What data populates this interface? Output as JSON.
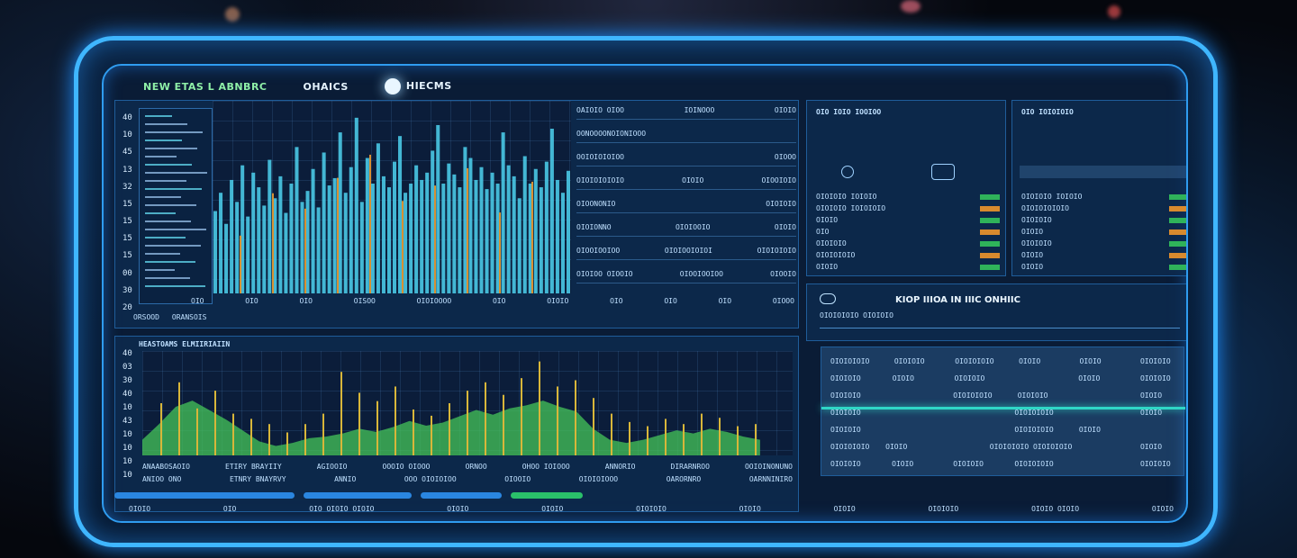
{
  "tabs": [
    {
      "label": "NEW ETAS L ABNBRC"
    },
    {
      "label": "OHAICS"
    },
    {
      "label": "HIECMS"
    }
  ],
  "chart_top": {
    "y_ticks": [
      "40",
      "10",
      "45",
      "13",
      "32",
      "15",
      "15",
      "15",
      "15",
      "00",
      "30",
      "20"
    ],
    "x_labels": [
      "OIO",
      "OIO",
      "OIO",
      "OISOO",
      "OIOIOOOO",
      "OIO",
      "OIOIO",
      "OIO",
      "OIO",
      "OIO",
      "OIOOO"
    ],
    "foot_labels": [
      "ORSOOD",
      "ORANSOIS"
    ],
    "heights": [
      0.45,
      0.55,
      0.38,
      0.62,
      0.5,
      0.7,
      0.42,
      0.66,
      0.58,
      0.48,
      0.73,
      0.52,
      0.64,
      0.44,
      0.6,
      0.8,
      0.5,
      0.56,
      0.68,
      0.47,
      0.77,
      0.59,
      0.63,
      0.88,
      0.55,
      0.69,
      0.96,
      0.5,
      0.74,
      0.6,
      0.82,
      0.64,
      0.58,
      0.72,
      0.86,
      0.55,
      0.6,
      0.7,
      0.62,
      0.66,
      0.78,
      0.92,
      0.6,
      0.71,
      0.65,
      0.58,
      0.8,
      0.74,
      0.62,
      0.69,
      0.57,
      0.66,
      0.6,
      0.88,
      0.7,
      0.64,
      0.52,
      0.75,
      0.6,
      0.68,
      0.58,
      0.72,
      0.9,
      0.62,
      0.55,
      0.67
    ],
    "accent_heights": [
      0.3,
      0.52,
      0.44,
      0.6,
      0.72,
      0.48,
      0.56,
      0.65,
      0.42,
      0.58
    ]
  },
  "chart_bottom": {
    "y_ticks": [
      "40",
      "03",
      "30",
      "40",
      "10",
      "43",
      "10",
      "10",
      "10",
      "10"
    ],
    "title": "HEASTOAMS ELMIIRIAIIN",
    "x_labels": [
      "ANAABOSAOIO",
      "ETIRY BRAYIIY",
      "AGIOOIO",
      "OOOIO OIOOO",
      "ORNOO",
      "OHOO IOIOOO",
      "ANNORIO",
      "DIRARNROO",
      "OOIOINONUNO"
    ],
    "x_labels2": [
      "ANIOO ONO",
      "ETNRY BNAYRVY",
      "ANNIO",
      "OOO OIOIOIOO",
      "OIOOIO",
      "OIOIOIOOO",
      "OARORNRO",
      "OARNNINIRO"
    ],
    "area": [
      0.2,
      0.4,
      0.62,
      0.7,
      0.58,
      0.46,
      0.32,
      0.18,
      0.12,
      0.16,
      0.22,
      0.24,
      0.28,
      0.34,
      0.3,
      0.36,
      0.44,
      0.38,
      0.42,
      0.5,
      0.58,
      0.52,
      0.6,
      0.64,
      0.7,
      0.62,
      0.56,
      0.34,
      0.2,
      0.16,
      0.2,
      0.26,
      0.32,
      0.28,
      0.34,
      0.3,
      0.24,
      0.2
    ],
    "spikes": [
      0.5,
      0.7,
      0.45,
      0.62,
      0.4,
      0.35,
      0.3,
      0.22,
      0.3,
      0.4,
      0.8,
      0.6,
      0.52,
      0.66,
      0.44,
      0.38,
      0.5,
      0.62,
      0.7,
      0.58,
      0.74,
      0.9,
      0.66,
      0.72,
      0.55,
      0.4,
      0.32,
      0.28,
      0.35,
      0.3,
      0.4,
      0.36,
      0.28,
      0.3
    ]
  },
  "mid_table": {
    "rows": [
      [
        "OAIOIO OIOO",
        "IOINOOO",
        "OIOIO"
      ],
      [
        "OONOOOONOIONIOOO",
        "",
        ""
      ],
      [
        "OOIOIOIOIOO",
        "",
        "OIOOO"
      ],
      [
        "OIOIOIOIOIO",
        "OIOIO",
        "OIOOIOIO"
      ],
      [
        "OIOONONIO",
        "",
        "OIOIOIO"
      ],
      [
        "OIOIONNO",
        "OIOIOOIO",
        "OIOIO"
      ],
      [
        "OIOOIOOIOO",
        "OIOIOOIOIOI",
        "OIOIOIOIO"
      ],
      [
        "OIOIOO OIOOIO",
        "OIOOIOOIOO",
        "OIOOIO"
      ]
    ]
  },
  "right_panel_a": {
    "header": "OIO IOIO IOOIOO",
    "rows": [
      "OIOIOIO IOIOIO",
      "OIOIOIO IOIOIOIO",
      "OIOIO",
      "OIO",
      "OIOIOIO",
      "OIOIOIOIO",
      "OIOIO"
    ]
  },
  "right_panel_b": {
    "header": "OIO IOIOIOIO",
    "rows": [
      "OIOIOIO IOIOIO",
      "OIOIOIOIOIO",
      "OIOIOIO",
      "OIOIO",
      "OIOIOIO",
      "OIOIO",
      "OIOIO"
    ]
  },
  "banner": {
    "title": "KIOP IIIOA IN IIIC ONHIIC",
    "sub": "OIOIOIOIO OIOIOIO"
  },
  "bottom_table": {
    "rows": [
      [
        "OIOIOIOIO",
        "OIOIOIO",
        "OIOIOIOIO",
        "OIOIO",
        "OIOIO",
        "OIOIOIO"
      ],
      [
        "OIOIOIO",
        "OIOIO",
        "OIOIOIO",
        "",
        "OIOIO",
        "OIOIOIO"
      ],
      [
        "OIOIOIO",
        "",
        "OIOIOIOIO",
        "OIOIOIO",
        "",
        "OIOIO"
      ],
      [
        "OIOIOIO",
        "",
        "",
        "OIOIOIOIO",
        "",
        "OIOIO"
      ],
      [
        "OIOIOIO",
        "",
        "",
        "OIOIOIOIO",
        "OIOIO",
        ""
      ],
      [
        "OIOIOIOIO",
        "OIOIO",
        "",
        "OIOIOIOIO OIOIOIOIO",
        "",
        "OIOIO"
      ],
      [
        "OIOIOIO",
        "OIOIO",
        "OIOIOIO",
        "OIOIOIOIO",
        "",
        "OIOIOIO"
      ]
    ]
  },
  "status_bar": [
    "OIOIO",
    "OIO",
    "OIO OIOIO OIOIO",
    "OIOIO",
    "OIOIO",
    "OIOIOIO",
    "OIOIO",
    "OIOIO",
    "OIOIOIO",
    "OIOIO OIOIO",
    "OIOIO"
  ],
  "colors": {
    "cyan": "#49c9e6",
    "orange": "#d89032",
    "green": "#46c65a",
    "yellow": "#d8b63a",
    "blue": "#3fb6ff"
  }
}
